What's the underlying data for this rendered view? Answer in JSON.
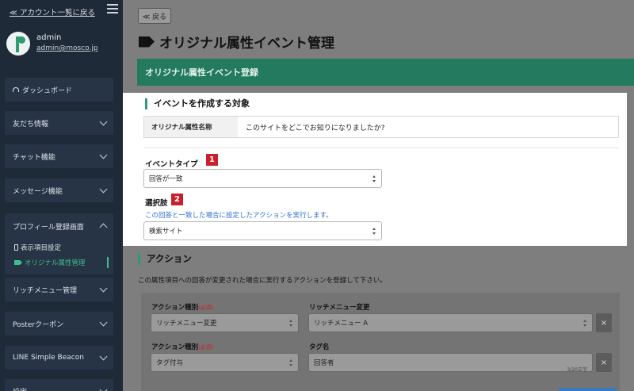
{
  "sidebar": {
    "back_link": "≪ アカウント一覧に戻る",
    "user_name": "admin",
    "user_email": "admin@mosco.jp",
    "items": [
      {
        "label": "ダッシュボード"
      },
      {
        "label": "友だち情報"
      },
      {
        "label": "チャット機能"
      },
      {
        "label": "メッセージ機能"
      },
      {
        "label": "プロフィール登録画面"
      },
      {
        "label": "リッチメニュー管理"
      },
      {
        "label": "Posterクーポン"
      },
      {
        "label": "LINE Simple Beacon"
      },
      {
        "label": "設定"
      }
    ],
    "sub_items": [
      {
        "label": "表示項目設定"
      },
      {
        "label": "オリジナル属性管理"
      }
    ]
  },
  "main": {
    "back_button": "≪ 戻る",
    "page_title": "オリジナル属性イベント管理",
    "banner": "オリジナル属性イベント登録",
    "target_section": "イベントを作成する対象",
    "attr_label": "オリジナル属性名称",
    "attr_value": "このサイトをどこでお知りになりましたか?",
    "event_type_label": "イベントタイプ",
    "event_type_badge": "1",
    "event_type_value": "回答が一致",
    "choice_label": "選択肢",
    "choice_badge": "2",
    "choice_hint": "この回答と一致した場合に設定したアクションを実行します。",
    "choice_value": "検索サイト",
    "action_section": "アクション",
    "action_desc": "この属性項目への回答が変更された場合に実行するアクションを登録して下さい。",
    "action_type_label": "アクション種別",
    "required": "(必須)",
    "action1_value": "リッチメニュー変更",
    "rich_menu_label": "リッチメニュー変更",
    "rich_menu_value": "リッチメニュー A",
    "action2_value": "タグ付与",
    "tag_label": "タグ名",
    "tag_value": "回答者",
    "tag_counter": "3/20文字",
    "remove": "×"
  },
  "colors": {
    "sidebar_bg": "#1f2a38",
    "accent_green": "#2e9b72",
    "badge_red": "#c8202c",
    "hint_blue": "#2f6fd6"
  }
}
